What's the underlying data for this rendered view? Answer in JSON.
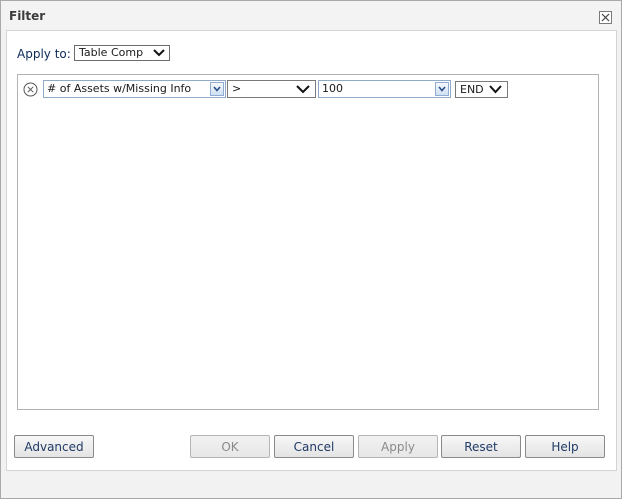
{
  "dialog": {
    "title": "Filter"
  },
  "apply_to": {
    "label": "Apply to:",
    "selected": "Table Comp"
  },
  "rule": {
    "field": "# of Assets w/Missing Info",
    "operator": ">",
    "value": "100",
    "conjunction": "END"
  },
  "buttons": {
    "advanced": "Advanced",
    "ok": "OK",
    "cancel": "Cancel",
    "apply": "Apply",
    "reset": "Reset",
    "help": "Help"
  },
  "icons": {
    "close": "close-icon",
    "remove_rule": "remove-circle-icon",
    "dropdown": "chevron-down-icon"
  },
  "colors": {
    "label_text": "#0d2a5a",
    "button_text": "#1f3a66",
    "combo_border": "#8fa9c9"
  }
}
